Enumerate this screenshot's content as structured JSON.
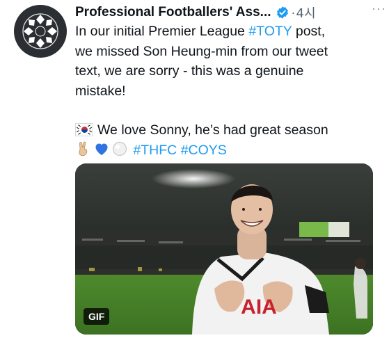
{
  "tweet": {
    "author_name": "Professional Footballers' Ass...",
    "dot": "·",
    "timestamp": "4시",
    "more_label": "···",
    "text_lines": [
      "In our initial Premier League ",
      "we missed Son Heung-min from our tweet",
      "text, we are sorry - this was a genuine",
      "mistake!"
    ],
    "hashtag_toty": "#TOTY",
    "text_line1_end": " post,",
    "love_text": "We love Sonny, he’s had great season",
    "hashtag_thfc": "#THFC",
    "hashtag_coys": "#COYS",
    "emoji_icons": [
      "victory-hand-icon",
      "blue-heart-icon",
      "white-circle-icon"
    ],
    "flag_icon": "south-korea-flag-icon"
  },
  "media": {
    "badge": "GIF",
    "jersey_text": "AIA"
  },
  "colors": {
    "link": "#1d9bf0",
    "text": "#0f1419",
    "secondary": "#536471",
    "verified": "#1d9bf0",
    "avatar_bg": "#2b2f33"
  }
}
